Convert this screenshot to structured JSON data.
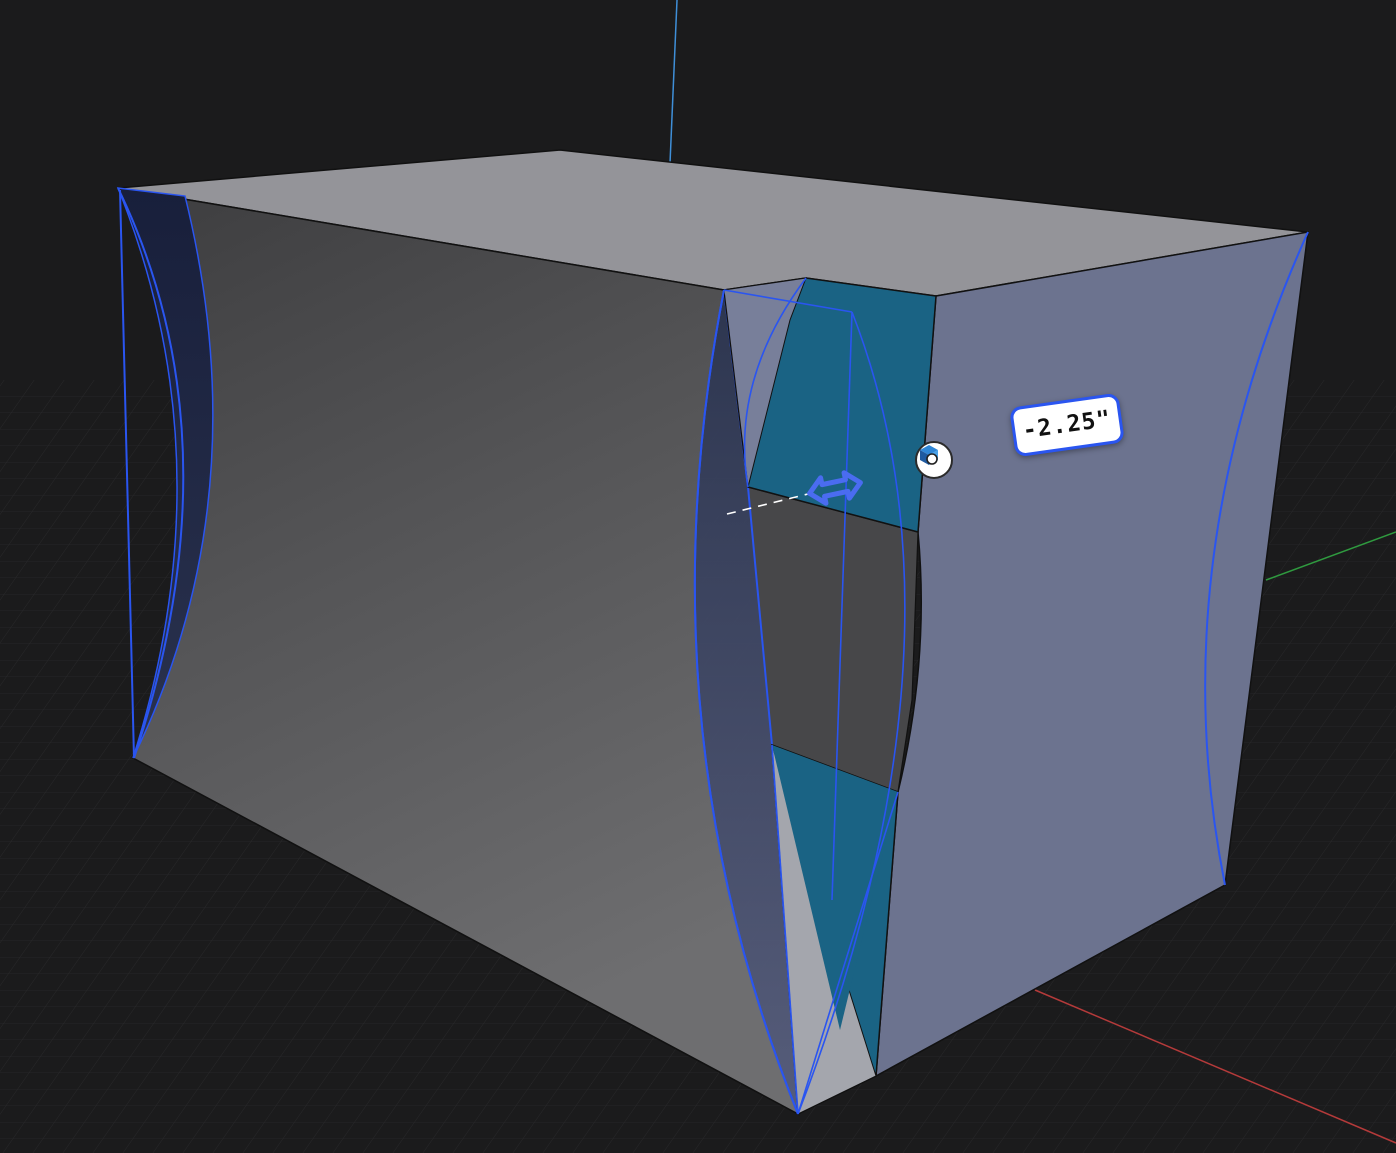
{
  "viewport": {
    "background": "#1b1b1c",
    "grid_color": "#2c2c2e",
    "axis_x_color": "#b43a3a",
    "axis_y_color": "#2f9a3f",
    "axis_z_color": "#3f8fd8"
  },
  "model": {
    "selection_color": "#2a55f0",
    "top_face_color": "#949499",
    "side_face_color": "#6c738f",
    "cut_face_color": "#1a6384"
  },
  "measurement": {
    "value": "-2.25\""
  },
  "icons": {
    "move_handle": "double-arrow-icon",
    "snap_marker": "component-snap-icon"
  }
}
